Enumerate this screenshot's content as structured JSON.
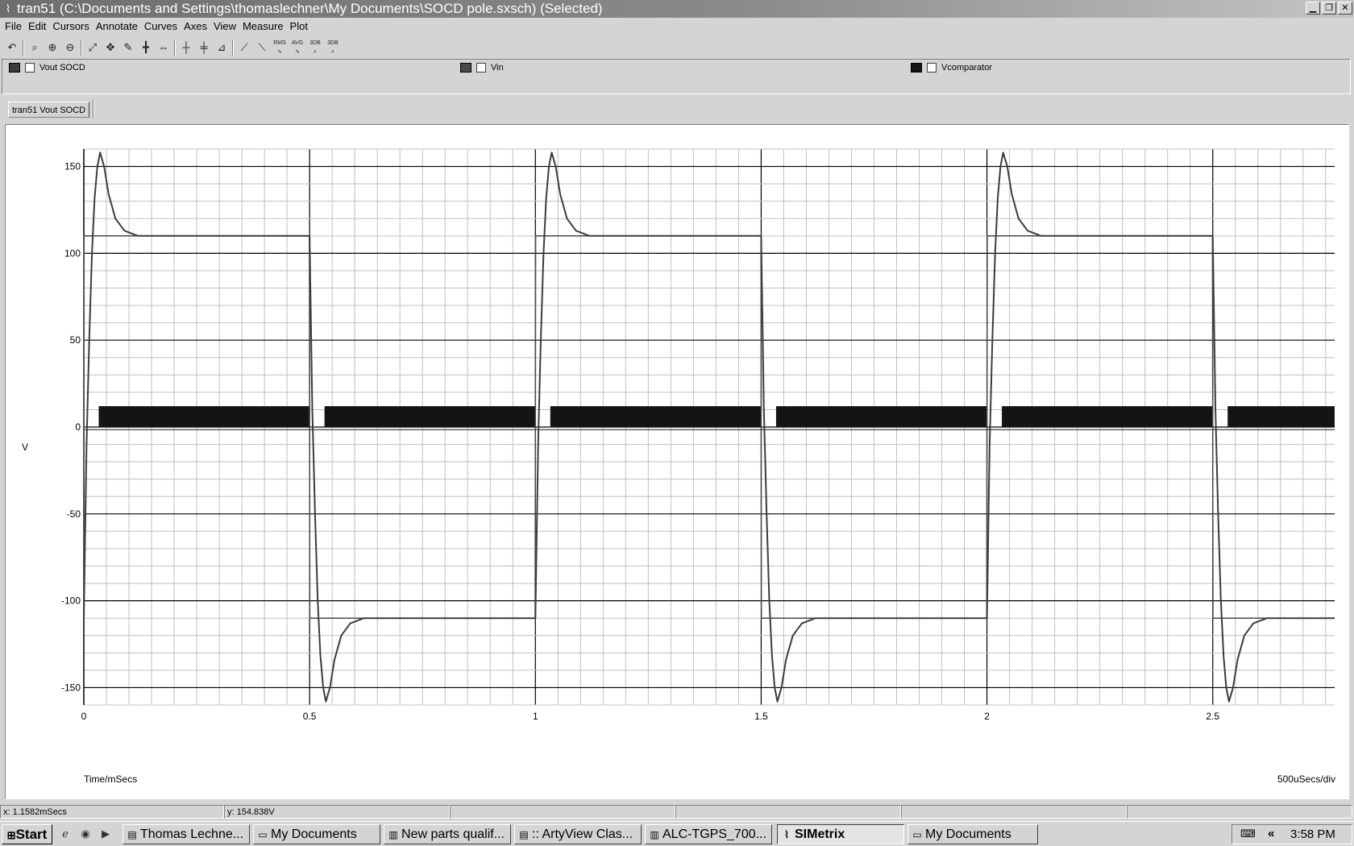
{
  "window": {
    "title": "tran51 (C:\\Documents and Settings\\thomaslechner\\My Documents\\SOCD pole.sxsch) (Selected)",
    "icon": "waveform-app-icon",
    "controls": [
      "minimize",
      "restore",
      "close"
    ]
  },
  "menu": [
    "File",
    "Edit",
    "Cursors",
    "Annotate",
    "Curves",
    "Axes",
    "View",
    "Measure",
    "Plot"
  ],
  "toolbar": {
    "icons": [
      "undo-icon",
      "zoom-box-icon",
      "zoom-in-icon",
      "zoom-out-icon",
      "fit-icon",
      "pan-icon",
      "text-label-icon",
      "cursor-add-icon",
      "cursor-move-icon",
      "new-axis-icon",
      "new-grid-icon",
      "log-axis-icon",
      "rise-icon",
      "fall-icon",
      "rms-icon",
      "avg-icon",
      "3db-high-icon",
      "3db-low-icon"
    ],
    "labels": [
      "RMS",
      "AVG",
      "3DB",
      "3DB"
    ]
  },
  "legend": [
    {
      "name": "Vout SOCD",
      "color": "#3c3c3c"
    },
    {
      "name": "Vin",
      "color": "#4a4a4a"
    },
    {
      "name": "Vcomparator",
      "color": "#141414"
    }
  ],
  "tab": {
    "label": "tran51 Vout SOCD"
  },
  "chart_data": {
    "type": "line",
    "title": "",
    "xlabel": "Time/mSecs",
    "ylabel": "V",
    "division_label": "500uSecs/div",
    "xlim": [
      0,
      2.77
    ],
    "ylim": [
      -160,
      160
    ],
    "xticks": [
      "0",
      "0.5",
      "1",
      "1.5",
      "2",
      "2.5"
    ],
    "yticks": [
      "150",
      "100",
      "50",
      "0",
      "-50",
      "-100",
      "-150"
    ],
    "grid": true,
    "series": [
      {
        "name": "Vout SOCD",
        "color": "#3c3c3c",
        "x": [
          0,
          0.006,
          0.012,
          0.018,
          0.024,
          0.03,
          0.036,
          0.045,
          0.055,
          0.07,
          0.09,
          0.12,
          0.499,
          0.5,
          0.506,
          0.512,
          0.518,
          0.524,
          0.53,
          0.536,
          0.545,
          0.555,
          0.57,
          0.59,
          0.62,
          0.999,
          1.0,
          1.006,
          1.012,
          1.018,
          1.024,
          1.03,
          1.036,
          1.045,
          1.055,
          1.07,
          1.09,
          1.12,
          1.499,
          1.5,
          1.506,
          1.512,
          1.518,
          1.524,
          1.53,
          1.536,
          1.545,
          1.555,
          1.57,
          1.59,
          1.62,
          1.999,
          2.0,
          2.006,
          2.012,
          2.018,
          2.024,
          2.03,
          2.036,
          2.045,
          2.055,
          2.07,
          2.09,
          2.12,
          2.499,
          2.5,
          2.506,
          2.512,
          2.518,
          2.524,
          2.53,
          2.536,
          2.545,
          2.555,
          2.57,
          2.59,
          2.62,
          2.77
        ],
        "y": [
          -110,
          -10,
          50,
          100,
          132,
          150,
          158,
          150,
          134,
          120,
          113,
          110,
          110,
          110,
          10,
          -50,
          -100,
          -132,
          -150,
          -158,
          -150,
          -134,
          -120,
          -113,
          -110,
          -110,
          -110,
          -10,
          50,
          100,
          132,
          150,
          158,
          150,
          134,
          120,
          113,
          110,
          110,
          110,
          10,
          -50,
          -100,
          -132,
          -150,
          -158,
          -150,
          -134,
          -120,
          -113,
          -110,
          -110,
          -110,
          -10,
          50,
          100,
          132,
          150,
          158,
          150,
          134,
          120,
          113,
          110,
          110,
          110,
          10,
          -50,
          -100,
          -132,
          -150,
          -158,
          -150,
          -134,
          -120,
          -113,
          -110,
          -110
        ]
      },
      {
        "name": "Vin",
        "color": "#4a4a4a",
        "x": [
          0,
          0.0005,
          0.4995,
          0.5005,
          0.9995,
          1.0005,
          1.4995,
          1.5005,
          1.9995,
          2.0005,
          2.4995,
          2.5005,
          2.77
        ],
        "y": [
          -110,
          110,
          110,
          -110,
          -110,
          110,
          110,
          -110,
          -110,
          110,
          110,
          -110,
          -110
        ]
      },
      {
        "name": "Vcomparator",
        "color": "#141414",
        "segments": [
          [
            0.033,
            0.5
          ],
          [
            0.533,
            1.0
          ],
          [
            1.033,
            1.5
          ],
          [
            1.533,
            2.0
          ],
          [
            2.033,
            2.5
          ],
          [
            2.533,
            2.77
          ]
        ],
        "high": 12,
        "low": 0
      }
    ]
  },
  "status": {
    "x_readout": "x: 1.1582mSecs",
    "y_readout": "y: 154.838V"
  },
  "taskbar": {
    "start": "Start",
    "quick_launch": [
      "ie-icon",
      "firefox-icon",
      "media-player-icon"
    ],
    "items": [
      {
        "label": "Thomas Lechne...",
        "icon": "browser-page-icon",
        "active": false
      },
      {
        "label": "My Documents",
        "icon": "folder-icon",
        "active": false
      },
      {
        "label": "New parts qualif...",
        "icon": "document-icon",
        "active": false
      },
      {
        "label": ":: ArtyView Clas...",
        "icon": "browser-page-icon",
        "active": false
      },
      {
        "label": "ALC-TGPS_700...",
        "icon": "document-icon",
        "active": false
      },
      {
        "label": "SIMetrix",
        "icon": "simetrix-icon",
        "active": true
      },
      {
        "label": "My Documents",
        "icon": "folder-icon",
        "active": false
      }
    ],
    "clock": "3:58 PM"
  }
}
